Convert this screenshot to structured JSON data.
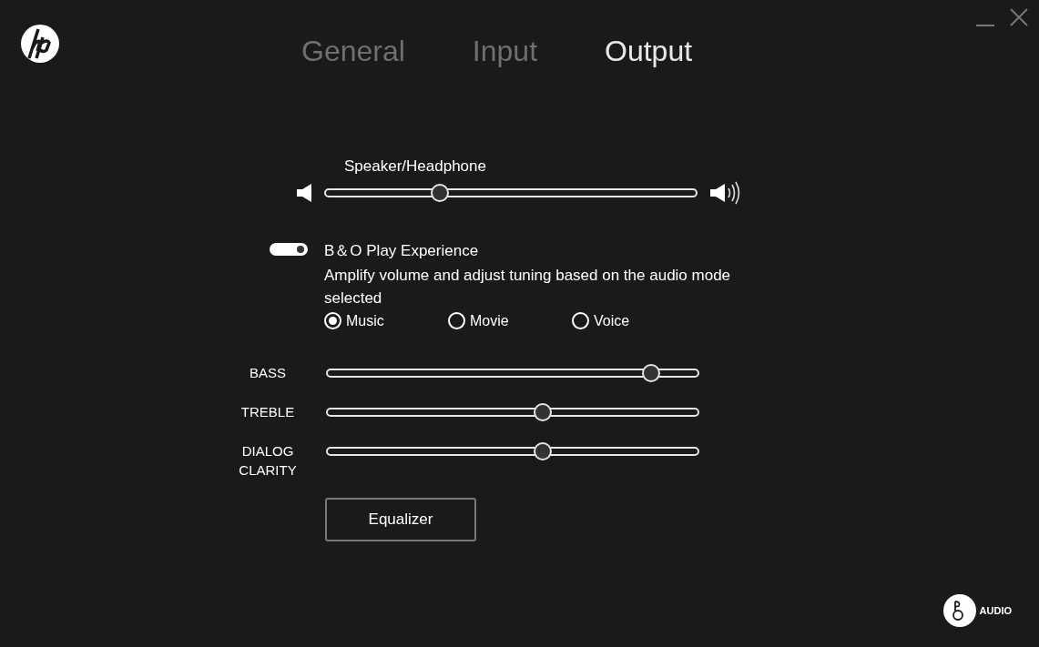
{
  "tabs": [
    {
      "label": "General",
      "selected": false
    },
    {
      "label": "Input",
      "selected": false
    },
    {
      "label": "Output",
      "selected": true
    }
  ],
  "volume": {
    "label": "Speaker/Headphone",
    "level": 0.31
  },
  "experience": {
    "title": "B＆O Play Experience",
    "on": true,
    "description": "Amplify volume and adjust tuning based on the audio mode selected"
  },
  "modes": [
    {
      "label": "Music",
      "selected": true
    },
    {
      "label": "Movie",
      "selected": false
    },
    {
      "label": "Voice",
      "selected": false
    }
  ],
  "sliders": [
    {
      "label": "BASS",
      "level": 0.87
    },
    {
      "label": "TREBLE",
      "level": 0.58
    },
    {
      "label": "DIALOG CLARITY",
      "level": 0.58
    }
  ],
  "equalizer_button": "Equalizer",
  "brand_footer": "AUDIO"
}
